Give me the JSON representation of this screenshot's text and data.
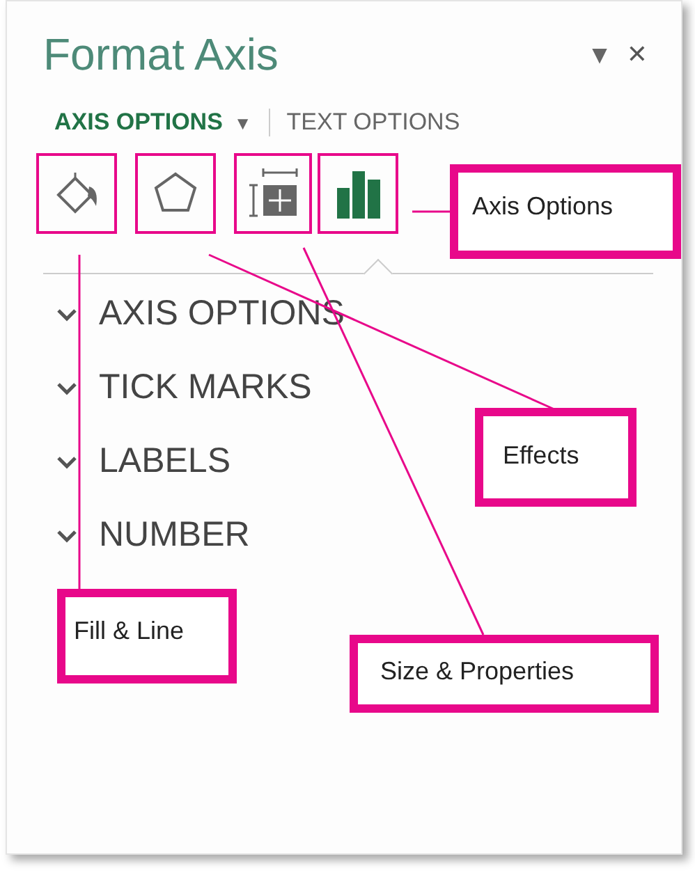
{
  "pane": {
    "title": "Format Axis",
    "menu_glyph": "▼",
    "close_glyph": "✕"
  },
  "tabs": [
    {
      "label": "AXIS OPTIONS",
      "selected": true,
      "caret": "▼"
    },
    {
      "label": "TEXT OPTIONS",
      "selected": false
    }
  ],
  "icon_tabs": [
    {
      "kind": "fill",
      "selected": false
    },
    {
      "kind": "effects",
      "selected": false
    },
    {
      "kind": "size",
      "selected": false
    },
    {
      "kind": "axis",
      "selected": true
    }
  ],
  "sections": [
    {
      "label": "AXIS OPTIONS"
    },
    {
      "label": "TICK MARKS"
    },
    {
      "label": "LABELS"
    },
    {
      "label": "NUMBER"
    }
  ],
  "callouts": [
    {
      "text": "Axis Options"
    },
    {
      "text": "Effects"
    },
    {
      "text": "Fill & Line"
    },
    {
      "text": "Size & Properties"
    }
  ]
}
